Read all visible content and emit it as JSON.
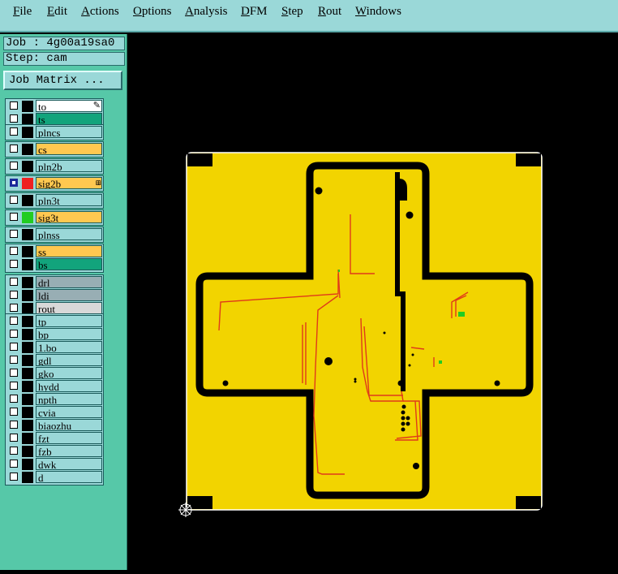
{
  "menubar": {
    "items": [
      {
        "mn": "F",
        "rest": "ile"
      },
      {
        "mn": "E",
        "rest": "dit"
      },
      {
        "mn": "A",
        "rest": "ctions"
      },
      {
        "mn": "O",
        "rest": "ptions"
      },
      {
        "mn": "A",
        "rest": "nalysis"
      },
      {
        "mn": "D",
        "rest": "FM"
      },
      {
        "mn": "S",
        "rest": "tep"
      },
      {
        "mn": "R",
        "rest": "out"
      },
      {
        "mn": "W",
        "rest": "indows"
      }
    ]
  },
  "job": {
    "job_text": "Job : 4g00a19sa0",
    "step_text": "Step: cam",
    "matrix_button": "Job Matrix ..."
  },
  "layers": [
    {
      "name": "to",
      "color": "#ffffff",
      "swatch": null,
      "extra": "pencil-icon"
    },
    {
      "name": "ts",
      "color": "#12a47c",
      "swatch": null
    },
    {
      "name": "plncs",
      "color": "#9ad8d8",
      "swatch": null
    },
    {
      "name": "cs",
      "color": "#ffc850",
      "swatch": null
    },
    {
      "name": "pln2b",
      "color": "#9ad8d8",
      "swatch": null
    },
    {
      "name": "sig2b",
      "color": "#ffc850",
      "swatch": "#ee2222",
      "chk": "#1a2a9a",
      "extra": "grid-icon"
    },
    {
      "name": "pln3t",
      "color": "#9ad8d8",
      "swatch": null
    },
    {
      "name": "sig3t",
      "color": "#ffc850",
      "swatch": "#22cc22"
    },
    {
      "name": "plnss",
      "color": "#9ad8d8",
      "swatch": null
    },
    {
      "name": "ss",
      "color": "#ffc850",
      "swatch": null
    },
    {
      "name": "bs",
      "color": "#12a47c",
      "swatch": null
    },
    {
      "name": "drl",
      "color": "#98aeb4",
      "swatch": null
    },
    {
      "name": "ldi",
      "color": "#98aeb4",
      "swatch": null
    },
    {
      "name": "rout",
      "color": "#d8d8d8",
      "swatch": null
    },
    {
      "name": "tp",
      "color": "#9ad8d8",
      "swatch": null
    },
    {
      "name": "bp",
      "color": "#9ad8d8",
      "swatch": null
    },
    {
      "name": "1.bo",
      "color": "#9ad8d8",
      "swatch": null
    },
    {
      "name": "gdl",
      "color": "#9ad8d8",
      "swatch": null
    },
    {
      "name": "gko",
      "color": "#9ad8d8",
      "swatch": null
    },
    {
      "name": "hydd",
      "color": "#9ad8d8",
      "swatch": null
    },
    {
      "name": "npth",
      "color": "#9ad8d8",
      "swatch": null
    },
    {
      "name": "cvia",
      "color": "#9ad8d8",
      "swatch": null
    },
    {
      "name": "biaozhu",
      "color": "#9ad8d8",
      "swatch": null
    },
    {
      "name": "fzt",
      "color": "#9ad8d8",
      "swatch": null
    },
    {
      "name": "fzb",
      "color": "#9ad8d8",
      "swatch": null
    },
    {
      "name": "dwk",
      "color": "#9ad8d8",
      "swatch": null
    },
    {
      "name": "d",
      "color": "#9ad8d8",
      "swatch": null
    }
  ],
  "colors": {
    "board": "#f2d400",
    "outline": "#000000",
    "trace": "#e03a1a",
    "pad": "#000000",
    "via": "#22cc22",
    "background": "#000000"
  }
}
